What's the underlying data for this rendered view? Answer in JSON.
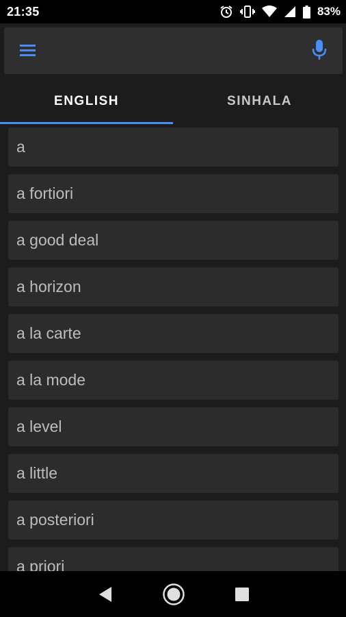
{
  "status_bar": {
    "time": "21:35",
    "battery_percent": "83%",
    "icons": [
      "alarm-icon",
      "vibrate-icon",
      "wifi-icon",
      "signal-icon",
      "battery-icon"
    ]
  },
  "search": {
    "value": "",
    "placeholder": "",
    "accent_color": "#4a8df6"
  },
  "tabs": [
    {
      "label": "ENGLISH",
      "active": true
    },
    {
      "label": "SINHALA",
      "active": false
    }
  ],
  "words": [
    "a",
    "a fortiori",
    "a good deal",
    "a horizon",
    "a la carte",
    "a la mode",
    "a level",
    "a little",
    "a posteriori",
    "a priori"
  ],
  "nav_bar": {
    "icons": [
      "back-icon",
      "home-icon",
      "recents-icon"
    ]
  }
}
